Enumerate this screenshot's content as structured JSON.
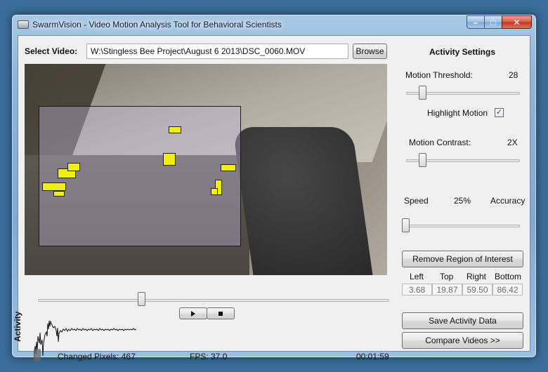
{
  "window": {
    "title": "SwarmVision - Video Motion Analysis Tool for Behavioral Scientists",
    "controls": {
      "minimize": "–",
      "maximize": "□",
      "close": "✕"
    }
  },
  "video_select": {
    "label": "Select Video:",
    "path": "W:\\Stingless Bee Project\\August 6 2013\\DSC_0060.MOV",
    "browse_label": "Browse"
  },
  "playback": {
    "play_icon": "play-icon",
    "stop_icon": "stop-icon",
    "progress": 0.29
  },
  "status": {
    "activity_label": "Activity",
    "changed_pixels": "Changed Pixels: 467",
    "fps": "FPS: 37.0",
    "time": "00:01:59"
  },
  "settings": {
    "title": "Activity Settings",
    "motion_threshold_label": "Motion Threshold:",
    "motion_threshold_value": "28",
    "motion_threshold_level": 0.12,
    "highlight_motion_label": "Highlight Motion",
    "highlight_motion_checked": true,
    "motion_contrast_label": "Motion Contrast:",
    "motion_contrast_value": "2X",
    "motion_contrast_level": 0.12,
    "speed_label": "Speed",
    "speed_value": "25%",
    "accuracy_label": "Accuracy",
    "speed_level": 0.0
  },
  "roi": {
    "remove_label": "Remove Region of Interest",
    "headers": [
      "Left",
      "Top",
      "Right",
      "Bottom"
    ],
    "values": [
      "3.68",
      "19.87",
      "59.50",
      "86.42"
    ]
  },
  "actions": {
    "save_label": "Save Activity Data",
    "compare_label": "Compare Videos >>"
  }
}
